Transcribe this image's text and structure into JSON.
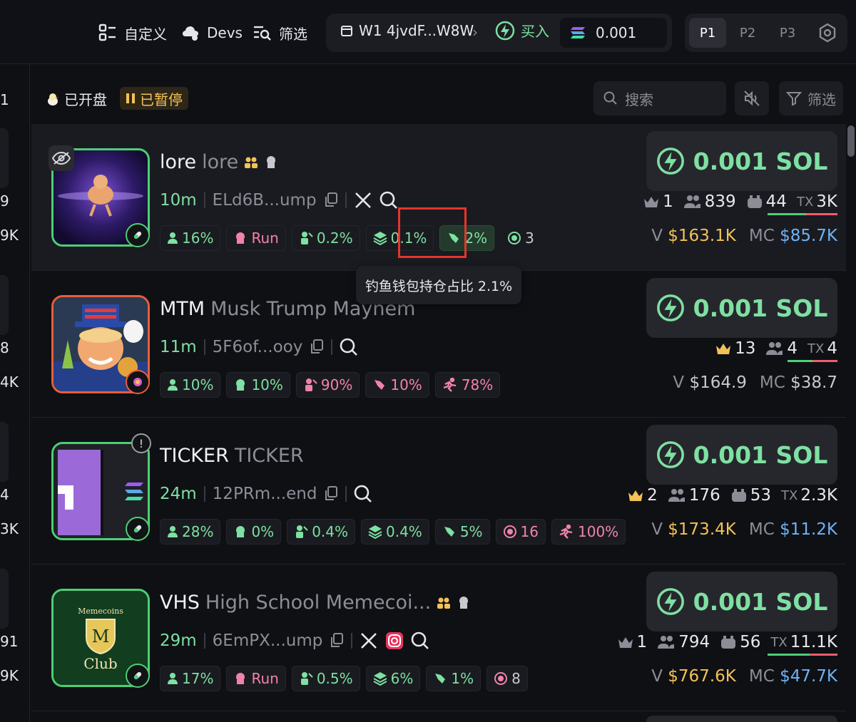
{
  "topbar": {
    "customize": "自定义",
    "devs": "Devs",
    "filter": "筛选",
    "wallet_name": "W1 4jvdF...W8W",
    "buy_label": "买入",
    "buy_amount": "0.001",
    "presets": [
      "P1",
      "P2",
      "P3"
    ]
  },
  "leftcol": {
    "texts": [
      "1",
      "9",
      "9K",
      "8",
      "4K",
      "4",
      "3K",
      "91",
      "9K"
    ]
  },
  "status": {
    "open": "已开盘",
    "paused": "已暂停"
  },
  "search": {
    "placeholder": "搜索"
  },
  "filter_label": "筛选",
  "tooltip": "钓鱼钱包持仓占比 2.1%",
  "cards": [
    {
      "ticker": "lore",
      "name": "lore",
      "age": "10m",
      "address": "ELd6B...ump",
      "stats": [
        [
          "16%",
          "green"
        ],
        [
          "Run",
          "pink"
        ],
        [
          "0.2%",
          "green"
        ],
        [
          "0.1%",
          "green"
        ],
        [
          "2%",
          "green"
        ],
        [
          "3",
          "plain"
        ]
      ],
      "sol": "0.001 SOL",
      "kings": "1",
      "holders": "839",
      "bots": "44",
      "tx_label": "TX",
      "tx": "3K",
      "v_label": "V",
      "v": "$163.1K",
      "mc_label": "MC",
      "mc": "$85.7K"
    },
    {
      "ticker": "MTM",
      "name": "Musk Trump Maynem",
      "age": "11m",
      "address": "5F6of...ooy",
      "stats": [
        [
          "10%",
          "green"
        ],
        [
          "10%",
          "green"
        ],
        [
          "90%",
          "pink"
        ],
        [
          "10%",
          "pink"
        ],
        [
          "78%",
          "pink"
        ]
      ],
      "sol": "0.001 SOL",
      "kings": "13",
      "holders": "4",
      "tx_label": "TX",
      "tx": "4",
      "v_label": "V",
      "v": "$164.9",
      "mc_label": "MC",
      "mc": "$38.7"
    },
    {
      "ticker": "TICKER",
      "name": "TICKER",
      "age": "24m",
      "address": "12PRm...end",
      "stats": [
        [
          "28%",
          "green"
        ],
        [
          "0%",
          "green"
        ],
        [
          "0.4%",
          "green"
        ],
        [
          "0.4%",
          "green"
        ],
        [
          "5%",
          "green"
        ],
        [
          "16",
          "pink"
        ],
        [
          "100%",
          "pink"
        ]
      ],
      "sol": "0.001 SOL",
      "kings": "2",
      "holders": "176",
      "bots": "53",
      "tx_label": "TX",
      "tx": "2.3K",
      "v_label": "V",
      "v": "$173.4K",
      "mc_label": "MC",
      "mc": "$11.2K"
    },
    {
      "ticker": "VHS",
      "name": "High School Memecoi...",
      "age": "29m",
      "address": "6EmPX...ump",
      "image_text": [
        "Memecoins",
        "Club"
      ],
      "stats": [
        [
          "17%",
          "green"
        ],
        [
          "Run",
          "pink"
        ],
        [
          "0.5%",
          "green"
        ],
        [
          "6%",
          "green"
        ],
        [
          "1%",
          "green"
        ],
        [
          "8",
          "plain"
        ]
      ],
      "sol": "0.001 SOL",
      "kings": "1",
      "holders": "794",
      "bots": "56",
      "tx_label": "TX",
      "tx": "11.1K",
      "v_label": "V",
      "v": "$767.6K",
      "mc_label": "MC",
      "mc": "$47.7K"
    }
  ]
}
